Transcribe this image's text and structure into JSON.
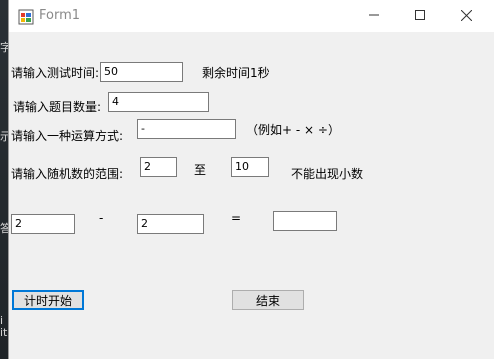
{
  "window": {
    "title": "Form1"
  },
  "desktop": {
    "glyphs": [
      "字",
      "示",
      "答",
      "i",
      "it"
    ]
  },
  "form": {
    "time_label": "请输入测试时间:",
    "time_value": "50",
    "remaining_label": "剩余时间1秒",
    "count_label": "请输入题目数量:",
    "count_value": "4",
    "op_label": "请输入一种运算方式:",
    "op_value": "-",
    "op_example": "（例如+ - × ÷）",
    "range_label": "请输入随机数的范围:",
    "range_min": "2",
    "range_to": "至",
    "range_max": "10",
    "no_decimal_label": "不能出现小数",
    "operand1": "2",
    "operator": "-",
    "operand2": "2",
    "equals": "=",
    "answer": "",
    "start_button": "计时开始",
    "end_button": "结束"
  }
}
